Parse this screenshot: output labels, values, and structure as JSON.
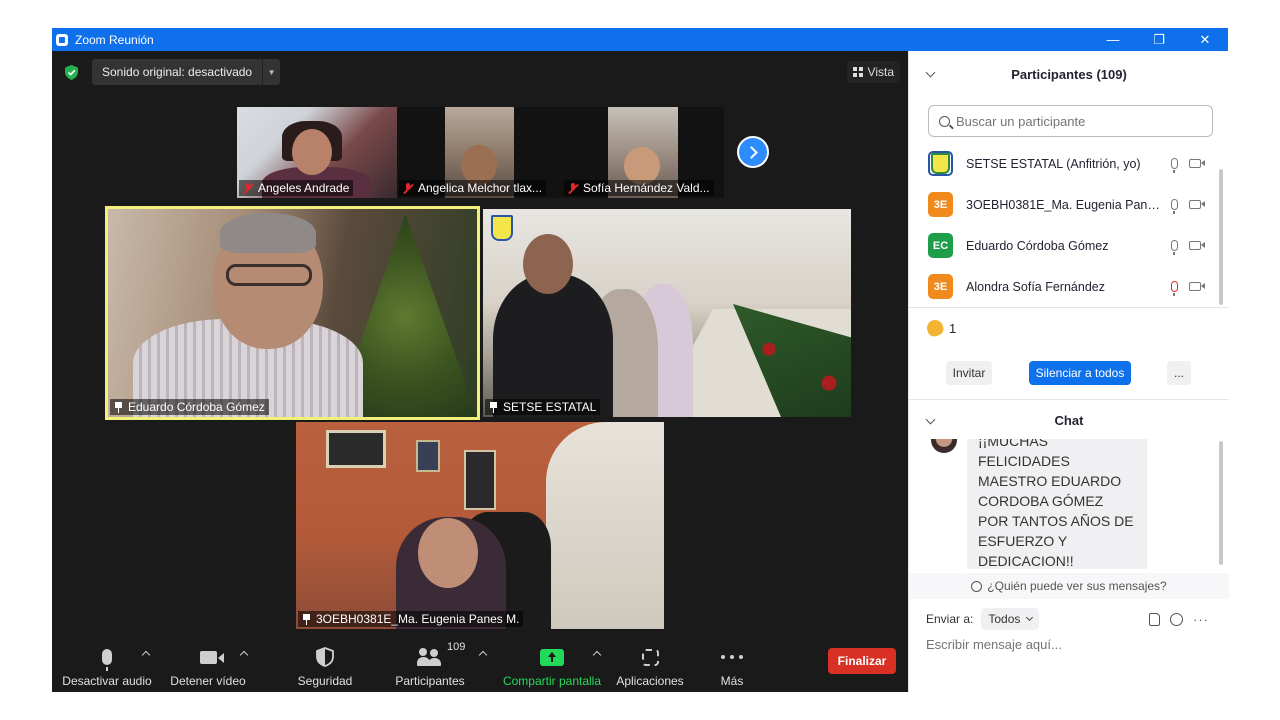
{
  "window": {
    "title": "Zoom Reunión",
    "minimize": "—",
    "restore": "❐",
    "close": "✕"
  },
  "meeting": {
    "audio_chip": "Sonido original: desactivado",
    "view_button": "Vista",
    "thumbnails": [
      {
        "name": "Angeles Andrade",
        "muted": true
      },
      {
        "name": "Angelica Melchor tlax...",
        "muted": true
      },
      {
        "name": "Sofía Hernández Vald...",
        "muted": true
      }
    ],
    "tiles": [
      {
        "name": "Eduardo Córdoba Gómez",
        "pinned": true,
        "active_speaker": true
      },
      {
        "name": "SETSE ESTATAL",
        "pinned": true
      },
      {
        "name": "3OEBH0381E_Ma. Eugenia Panes M.",
        "pinned": true
      }
    ]
  },
  "toolbar": {
    "audio": "Desactivar audio",
    "video": "Detener vídeo",
    "security": "Seguridad",
    "participants": "Participantes",
    "participants_count": "109",
    "share": "Compartir pantalla",
    "apps": "Aplicaciones",
    "more": "Más",
    "end": "Finalizar"
  },
  "panel": {
    "participants_title": "Participantes (109)",
    "search_placeholder": "Buscar un participante",
    "participants": [
      {
        "initials": "",
        "name": "SETSE ESTATAL (Anfitrión, yo)",
        "color": "#ffffff",
        "mic_muted": false
      },
      {
        "initials": "3E",
        "name": "3OEBH0381E_Ma. Eugenia Pane...",
        "color": "#f08a1c",
        "mic_muted": true
      },
      {
        "initials": "EC",
        "name": "Eduardo Córdoba Gómez",
        "color": "#1f9e4a",
        "mic_muted": false
      },
      {
        "initials": "3E",
        "name": "Alondra Sofía Fernández",
        "color": "#f08a1c",
        "mic_muted": true
      }
    ],
    "reaction_count": "1",
    "invite": "Invitar",
    "mute_all": "Silenciar a todos",
    "more": "...",
    "chat_title": "Chat",
    "chat_message": "¡¡MUCHAS FELICIDADES MAESTRO EDUARDO CORDOBA GÓMEZ POR TANTOS AÑOS DE ESFUERZO Y DEDICACION!!",
    "who_sees": "¿Quién puede ver sus mensajes?",
    "send_to_label": "Enviar a:",
    "send_to_value": "Todos",
    "message_placeholder": "Escribir mensaje aquí..."
  }
}
